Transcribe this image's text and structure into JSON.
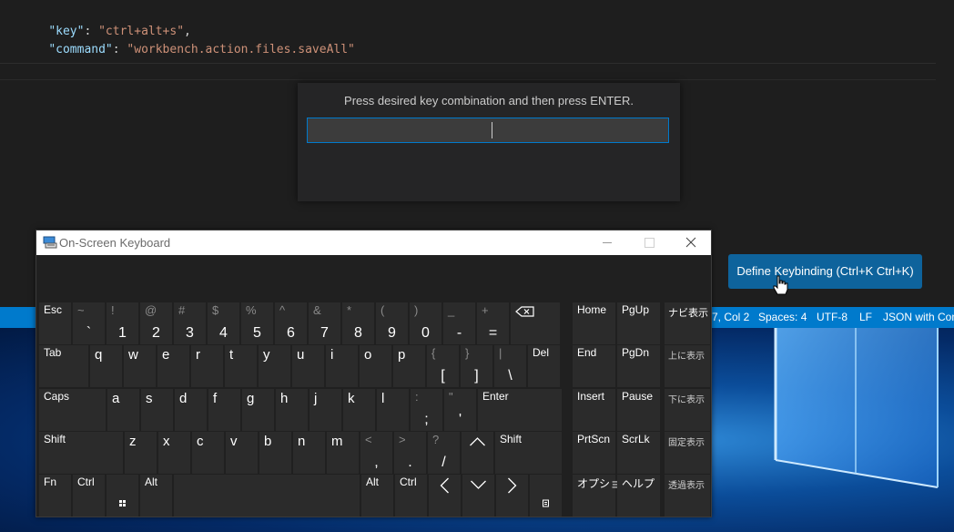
{
  "editor": {
    "line1": {
      "key": "\"key\"",
      "colon": ": ",
      "value": "\"ctrl+alt+s\"",
      "comma": ","
    },
    "line2": {
      "key": "\"command\"",
      "colon": ": ",
      "value": "\"workbench.action.files.saveAll\""
    },
    "keybinding_widget": {
      "message": "Press desired key combination and then press ENTER.",
      "input_value": ""
    },
    "define_button": "Define Keybinding (Ctrl+K Ctrl+K)"
  },
  "statusbar": {
    "position": "7, Col 2",
    "spaces": "Spaces: 4",
    "encoding": "UTF-8",
    "eol": "LF",
    "language": "JSON with Con"
  },
  "osk": {
    "title": "On-Screen Keyboard",
    "icons": {
      "app": "keyboard-icon",
      "minimize": "minimize-icon",
      "maximize": "maximize-icon",
      "close": "close-icon"
    },
    "row1": [
      {
        "top": "Esc"
      },
      {
        "shift": "~",
        "main": "`"
      },
      {
        "shift": "!",
        "main": "1"
      },
      {
        "shift": "@",
        "main": "2"
      },
      {
        "shift": "#",
        "main": "3"
      },
      {
        "shift": "$",
        "main": "4"
      },
      {
        "shift": "%",
        "main": "5"
      },
      {
        "shift": "^",
        "main": "6"
      },
      {
        "shift": "&",
        "main": "7"
      },
      {
        "shift": "*",
        "main": "8"
      },
      {
        "shift": "(",
        "main": "9"
      },
      {
        "shift": ")",
        "main": "0"
      },
      {
        "shift": "_",
        "main": "-"
      },
      {
        "shift": "+",
        "main": "="
      },
      {
        "icon": "backspace-icon"
      }
    ],
    "row2": [
      {
        "top": "Tab"
      },
      {
        "letter": "q"
      },
      {
        "letter": "w"
      },
      {
        "letter": "e"
      },
      {
        "letter": "r"
      },
      {
        "letter": "t"
      },
      {
        "letter": "y"
      },
      {
        "letter": "u"
      },
      {
        "letter": "i"
      },
      {
        "letter": "o"
      },
      {
        "letter": "p"
      },
      {
        "shift": "{",
        "main": "["
      },
      {
        "shift": "}",
        "main": "]"
      },
      {
        "shift": "|",
        "main": "\\"
      },
      {
        "top": "Del"
      }
    ],
    "row3": [
      {
        "top": "Caps"
      },
      {
        "letter": "a"
      },
      {
        "letter": "s"
      },
      {
        "letter": "d"
      },
      {
        "letter": "f"
      },
      {
        "letter": "g"
      },
      {
        "letter": "h"
      },
      {
        "letter": "j"
      },
      {
        "letter": "k"
      },
      {
        "letter": "l"
      },
      {
        "shift": ":",
        "main": ";"
      },
      {
        "shift": "\"",
        "main": "'"
      },
      {
        "top": "Enter"
      }
    ],
    "row4": [
      {
        "top": "Shift"
      },
      {
        "letter": "z"
      },
      {
        "letter": "x"
      },
      {
        "letter": "c"
      },
      {
        "letter": "v"
      },
      {
        "letter": "b"
      },
      {
        "letter": "n"
      },
      {
        "letter": "m"
      },
      {
        "shift": "<",
        "main": ","
      },
      {
        "shift": ">",
        "main": "."
      },
      {
        "shift": "?",
        "main": "/"
      },
      {
        "icon": "arrow-up-icon"
      },
      {
        "top": "Shift"
      }
    ],
    "row5": [
      {
        "top": "Fn"
      },
      {
        "top": "Ctrl"
      },
      {
        "icon": "windows-icon"
      },
      {
        "top": "Alt"
      },
      {
        "top": ""
      },
      {
        "top": "Alt"
      },
      {
        "top": "Ctrl"
      },
      {
        "icon": "arrow-left-icon"
      },
      {
        "icon": "arrow-down-icon"
      },
      {
        "icon": "arrow-right-icon"
      },
      {
        "icon": "menu-icon"
      }
    ],
    "nav": [
      {
        "top": "Home"
      },
      {
        "top": "PgUp"
      },
      {
        "top": "End"
      },
      {
        "top": "PgDn"
      },
      {
        "top": "Insert"
      },
      {
        "top": "Pause"
      },
      {
        "top": "PrtScn"
      },
      {
        "top": "ScrLk"
      },
      {
        "top": "オプション"
      },
      {
        "top": "ヘルプ"
      }
    ],
    "jp": [
      "ナビ表示",
      "上に表示",
      "下に表示",
      "固定表示",
      "透過表示"
    ]
  }
}
